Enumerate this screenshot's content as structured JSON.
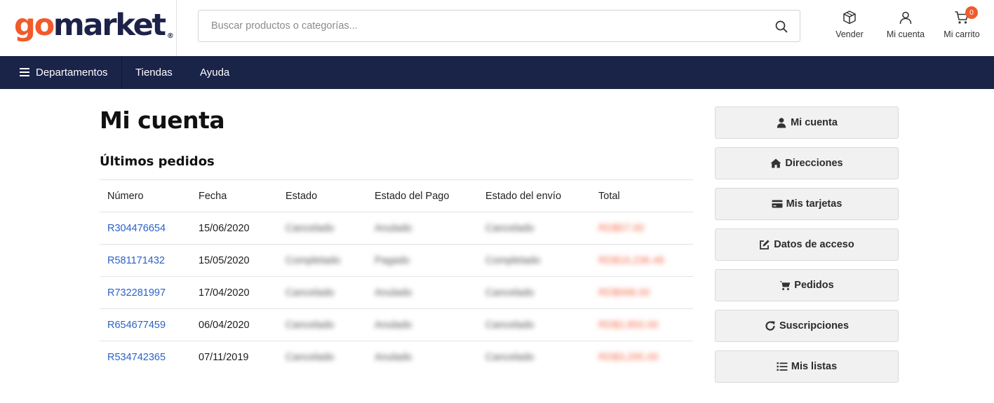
{
  "header": {
    "logo_go": "go",
    "logo_market": "market",
    "logo_reg": "®",
    "search_placeholder": "Buscar productos o categorías...",
    "actions": {
      "vender": "Vender",
      "mi_cuenta": "Mi cuenta",
      "mi_carrito": "Mi carrito",
      "cart_count": "0"
    }
  },
  "nav": {
    "departamentos": "Departamentos",
    "tiendas": "Tiendas",
    "ayuda": "Ayuda"
  },
  "main": {
    "title": "Mi cuenta",
    "section_title": "Últimos pedidos",
    "columns": [
      "Número",
      "Fecha",
      "Estado",
      "Estado del Pago",
      "Estado del envío",
      "Total"
    ],
    "orders": [
      {
        "numero": "R304476654",
        "fecha": "15/06/2020",
        "estado": "Cancelado",
        "pago": "Anulado",
        "envio": "Cancelado",
        "total": "RD$57.00"
      },
      {
        "numero": "R581171432",
        "fecha": "15/05/2020",
        "estado": "Completado",
        "pago": "Pagado",
        "envio": "Completado",
        "total": "RD$16,236.48"
      },
      {
        "numero": "R732281997",
        "fecha": "17/04/2020",
        "estado": "Cancelado",
        "pago": "Anulado",
        "envio": "Cancelado",
        "total": "RD$998.00"
      },
      {
        "numero": "R654677459",
        "fecha": "06/04/2020",
        "estado": "Cancelado",
        "pago": "Anulado",
        "envio": "Cancelado",
        "total": "RD$2,850.00"
      },
      {
        "numero": "R534742365",
        "fecha": "07/11/2019",
        "estado": "Cancelado",
        "pago": "Anulado",
        "envio": "Cancelado",
        "total": "RD$3,295.00"
      }
    ]
  },
  "sidebar": {
    "items": [
      {
        "label": "Mi cuenta",
        "icon": "user-icon"
      },
      {
        "label": "Direcciones",
        "icon": "home-icon"
      },
      {
        "label": "Mis tarjetas",
        "icon": "credit-card-icon"
      },
      {
        "label": "Datos de acceso",
        "icon": "edit-icon"
      },
      {
        "label": "Pedidos",
        "icon": "shopping-cart-icon"
      },
      {
        "label": "Suscripciones",
        "icon": "refresh-icon"
      },
      {
        "label": "Mis listas",
        "icon": "list-icon"
      }
    ]
  },
  "colors": {
    "brand_orange": "#f15a2b",
    "brand_navy": "#1a2348",
    "link_blue": "#2a62c9"
  }
}
